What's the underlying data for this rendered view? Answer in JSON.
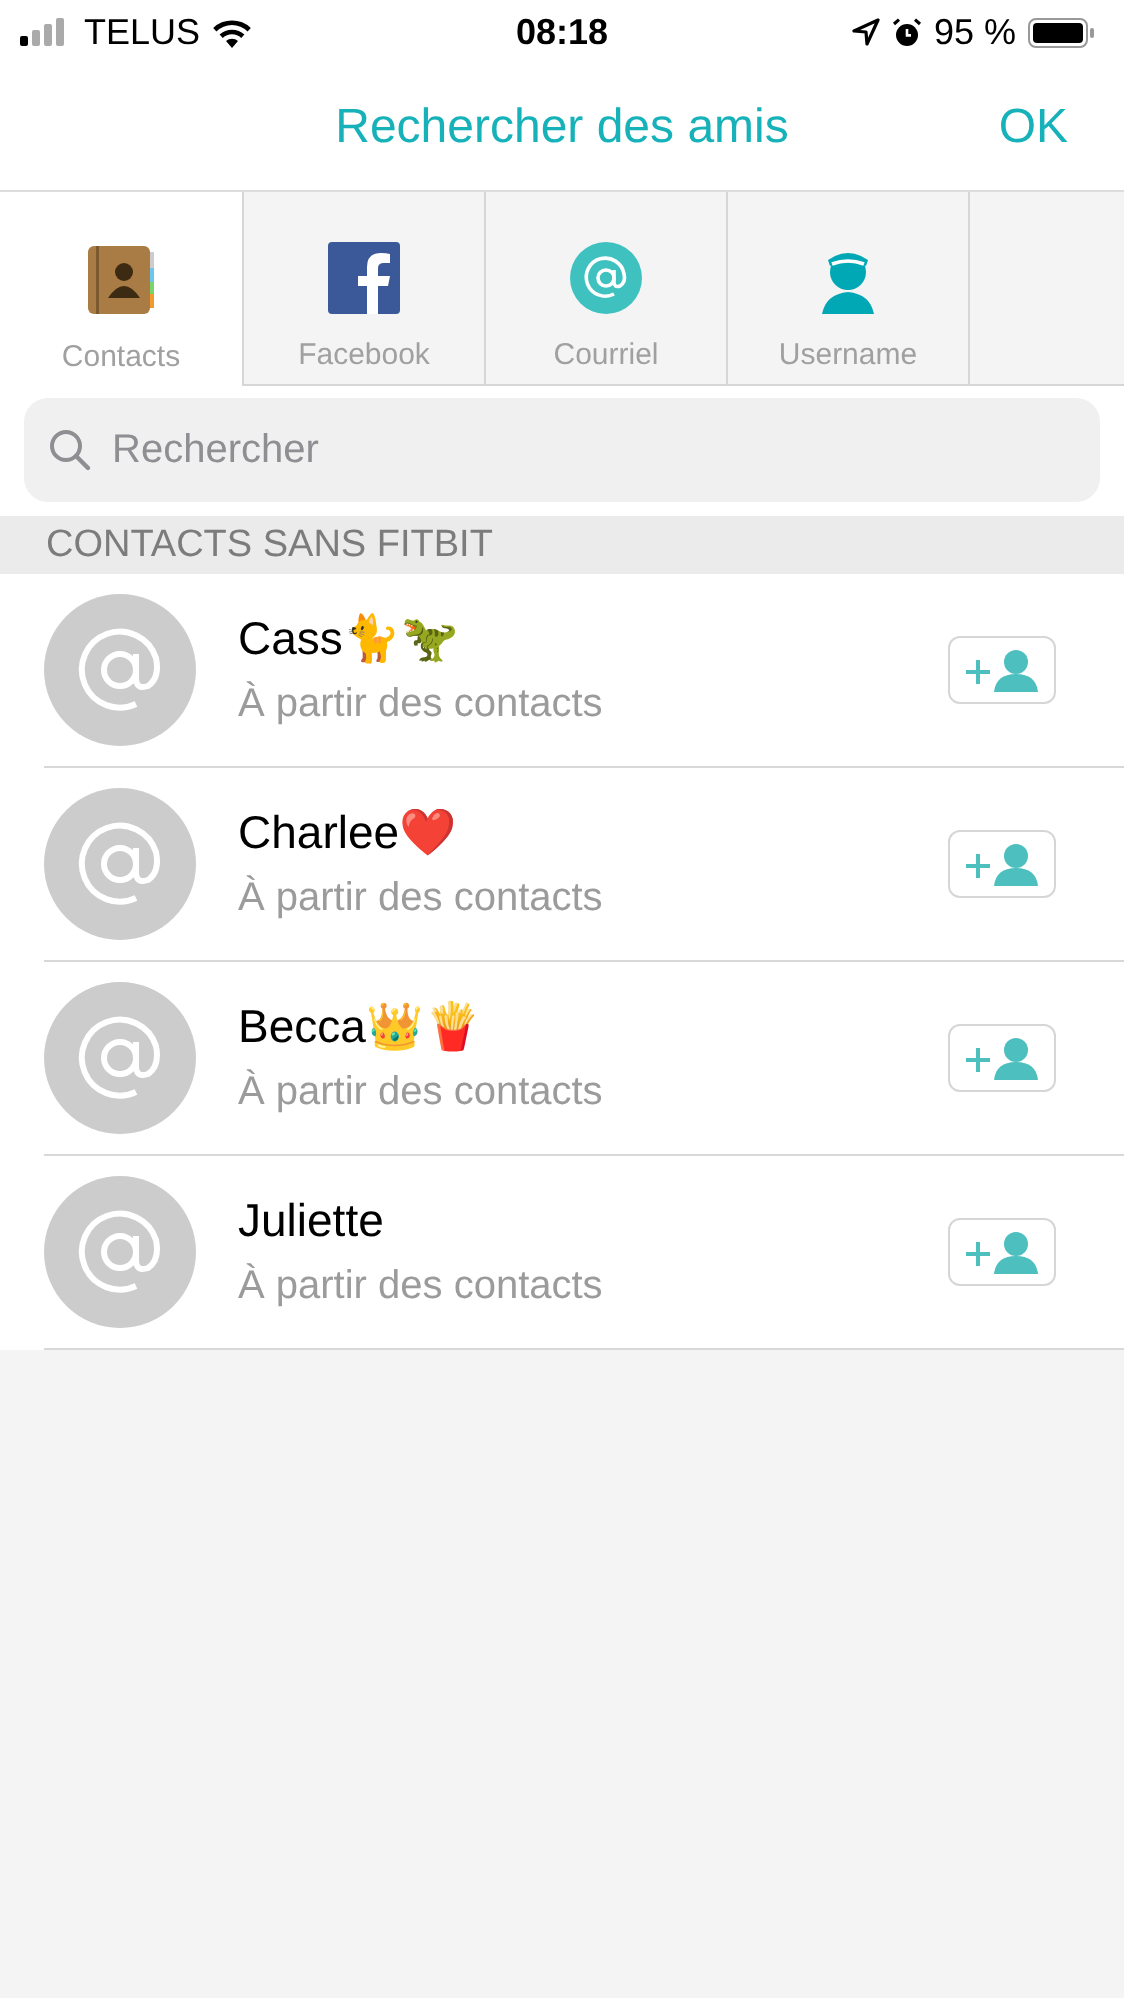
{
  "status_bar": {
    "carrier": "TELUS",
    "time": "08:18",
    "battery": "95 %"
  },
  "header": {
    "title": "Rechercher des amis",
    "action": "OK"
  },
  "tabs": [
    {
      "label": "Contacts",
      "kind": "book",
      "selected": true
    },
    {
      "label": "Facebook",
      "kind": "letter",
      "selected": false
    },
    {
      "label": "Courriel",
      "kind": "at",
      "selected": false
    },
    {
      "label": "Username",
      "kind": "person",
      "selected": false
    }
  ],
  "search": {
    "placeholder": "Rechercher"
  },
  "section": {
    "title": "CONTACTS SANS FITBIT"
  },
  "contacts": [
    {
      "name": "Cass🐈🦖",
      "source": "À partir des contacts"
    },
    {
      "name": "Charlee❤️",
      "source": "À partir des contacts"
    },
    {
      "name": "Becca👑🍟",
      "source": "À partir des contacts"
    },
    {
      "name": "Juliette",
      "source": "À partir des contacts"
    }
  ]
}
